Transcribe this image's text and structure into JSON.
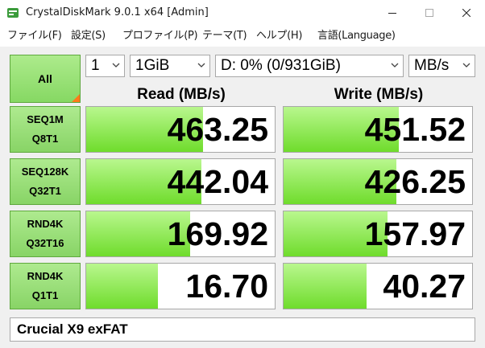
{
  "window": {
    "title": "CrystalDiskMark 9.0.1 x64 [Admin]",
    "controls": {
      "minimize": "minimize-icon",
      "maximize": "maximize-icon",
      "close": "close-icon"
    }
  },
  "menu": [
    "ファイル(F)",
    "設定(S)",
    "プロファイル(P)",
    "テーマ(T)",
    "ヘルプ(H)",
    "言語(Language)"
  ],
  "toolbar": {
    "all_label": "All",
    "count": "1",
    "size": "1GiB",
    "drive": "D: 0% (0/931GiB)",
    "unit": "MB/s"
  },
  "headers": {
    "read": "Read (MB/s)",
    "write": "Write (MB/s)"
  },
  "tests": [
    {
      "line1": "SEQ1M",
      "line2": "Q8T1",
      "read": "463.25",
      "write": "451.52"
    },
    {
      "line1": "SEQ128K",
      "line2": "Q32T1",
      "read": "442.04",
      "write": "426.25"
    },
    {
      "line1": "RND4K",
      "line2": "Q32T16",
      "read": "169.92",
      "write": "157.97"
    },
    {
      "line1": "RND4K",
      "line2": "Q1T1",
      "read": "16.70",
      "write": "40.27"
    }
  ],
  "bar_fill_fraction": [
    {
      "read": 0.62,
      "write": 0.61
    },
    {
      "read": 0.61,
      "write": 0.6
    },
    {
      "read": 0.55,
      "write": 0.55
    },
    {
      "read": 0.38,
      "write": 0.44
    }
  ],
  "comment": "Crucial X9 exFAT",
  "colors": {
    "bar_light": "#b9f78e",
    "bar_dark": "#6fdc2c",
    "button_green": "#86d863",
    "accent_orange": "#ff7a1a"
  }
}
